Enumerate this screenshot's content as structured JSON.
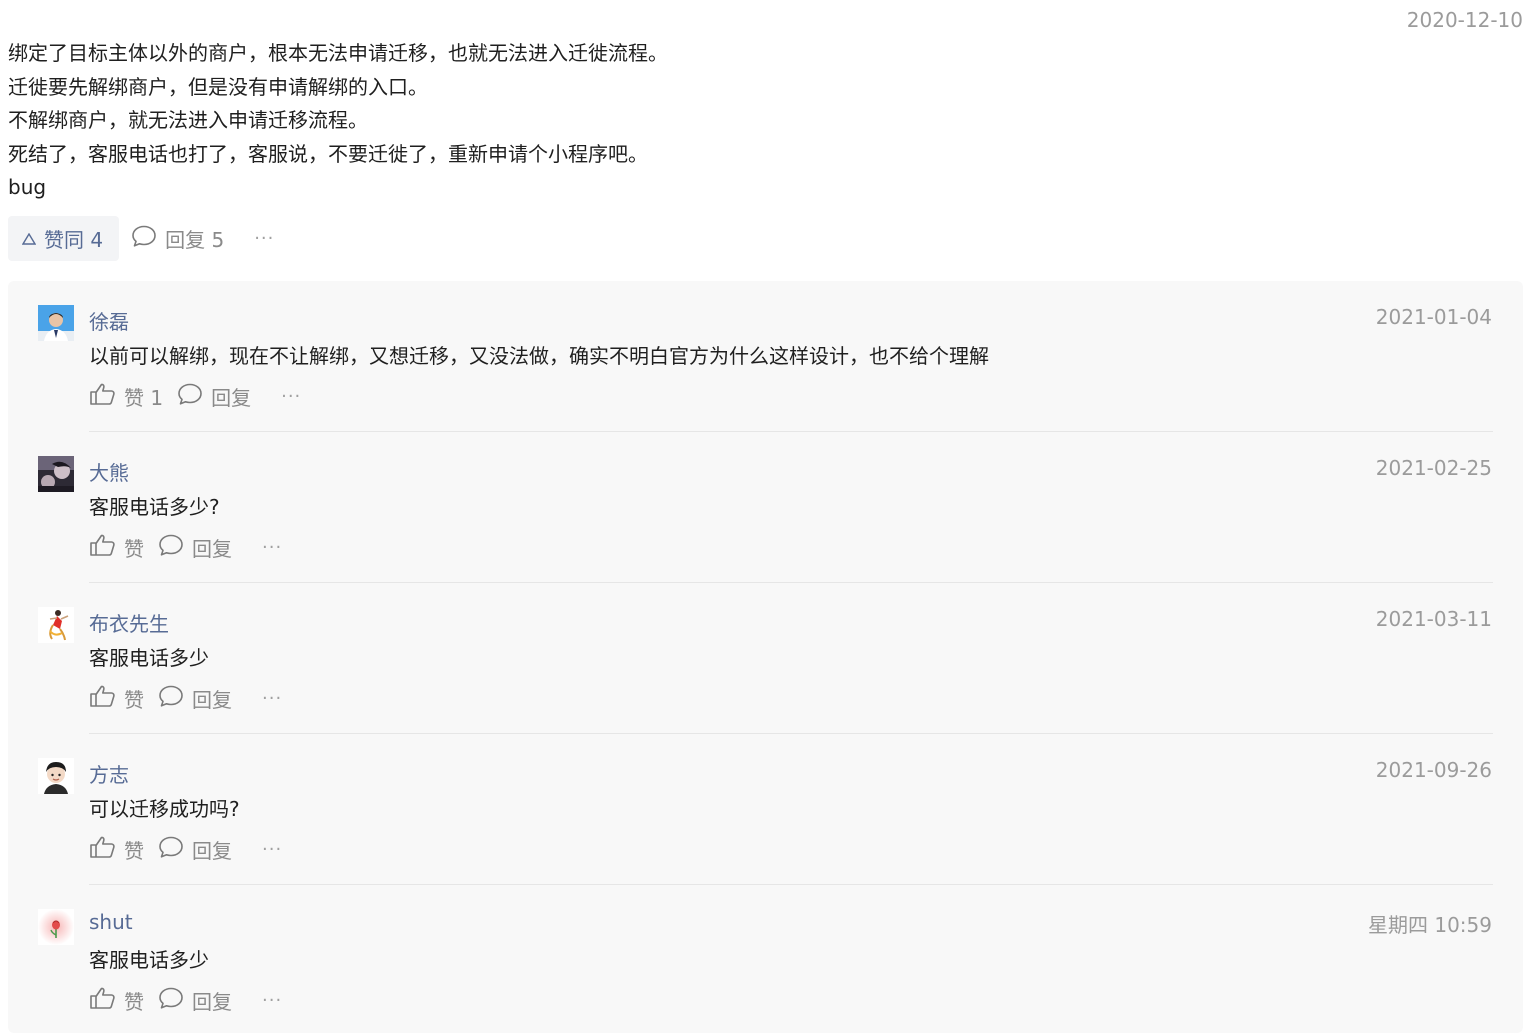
{
  "post": {
    "date": "2020-12-10",
    "lines": [
      "绑定了目标主体以外的商户，根本无法申请迁移，也就无法进入迁徙流程。",
      "迁徙要先解绑商户，但是没有申请解绑的入口。",
      "不解绑商户，就无法进入申请迁移流程。",
      "死结了，客服电话也打了，客服说，不要迁徙了，重新申请个小程序吧。",
      "bug"
    ],
    "like_label": "赞同 4",
    "reply_label": "回复 5",
    "more_label": "···"
  },
  "comments": [
    {
      "name": "徐磊",
      "date": "2021-01-04",
      "text": "以前可以解绑，现在不让解绑，又想迁移，又没法做，确实不明白官方为什么这样设计，也不给个理解",
      "like_label": "赞 1",
      "reply_label": "回复",
      "more_label": "···",
      "avatar": "person-photo"
    },
    {
      "name": "大熊",
      "date": "2021-02-25",
      "text": "客服电话多少?",
      "like_label": "赞",
      "reply_label": "回复",
      "more_label": "···",
      "avatar": "dark-photo"
    },
    {
      "name": "布衣先生",
      "date": "2021-03-11",
      "text": "客服电话多少",
      "like_label": "赞",
      "reply_label": "回复",
      "more_label": "···",
      "avatar": "dancer-figure"
    },
    {
      "name": "方志",
      "date": "2021-09-26",
      "text": "可以迁移成功吗?",
      "like_label": "赞",
      "reply_label": "回复",
      "more_label": "···",
      "avatar": "cartoon-face"
    },
    {
      "name": "shut",
      "date": "星期四 10:59",
      "text": "客服电话多少",
      "like_label": "赞",
      "reply_label": "回复",
      "more_label": "···",
      "avatar": "flower"
    }
  ],
  "colors": {
    "link": "#576b95",
    "meta": "#9b9b9b",
    "thread_bg": "#f8f8f8"
  }
}
